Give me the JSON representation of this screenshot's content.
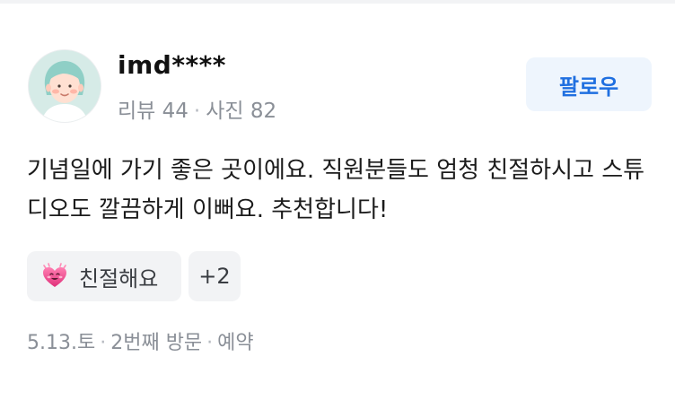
{
  "review": {
    "author": {
      "username": "imd****",
      "reviews_label": "리뷰 44",
      "photos_label": "사진 82"
    },
    "follow_label": "팔로우",
    "body": "기념일에 가기 좋은 곳이에요. 직원분들도 엄청 친절하시고 스튜디오도 깔끔하게 이뻐요. 추천합니다!",
    "tags": [
      {
        "label": "친절해요",
        "icon": "smiling-heart-icon"
      }
    ],
    "more_tags_label": "+2",
    "footer": {
      "date": "5.13.토",
      "visit": "2번째 방문",
      "type": "예약"
    }
  },
  "colors": {
    "accent": "#1f6fe0",
    "follow_bg": "#eef5fd",
    "muted_text": "#8a8f97",
    "chip_bg": "#f2f3f5"
  }
}
